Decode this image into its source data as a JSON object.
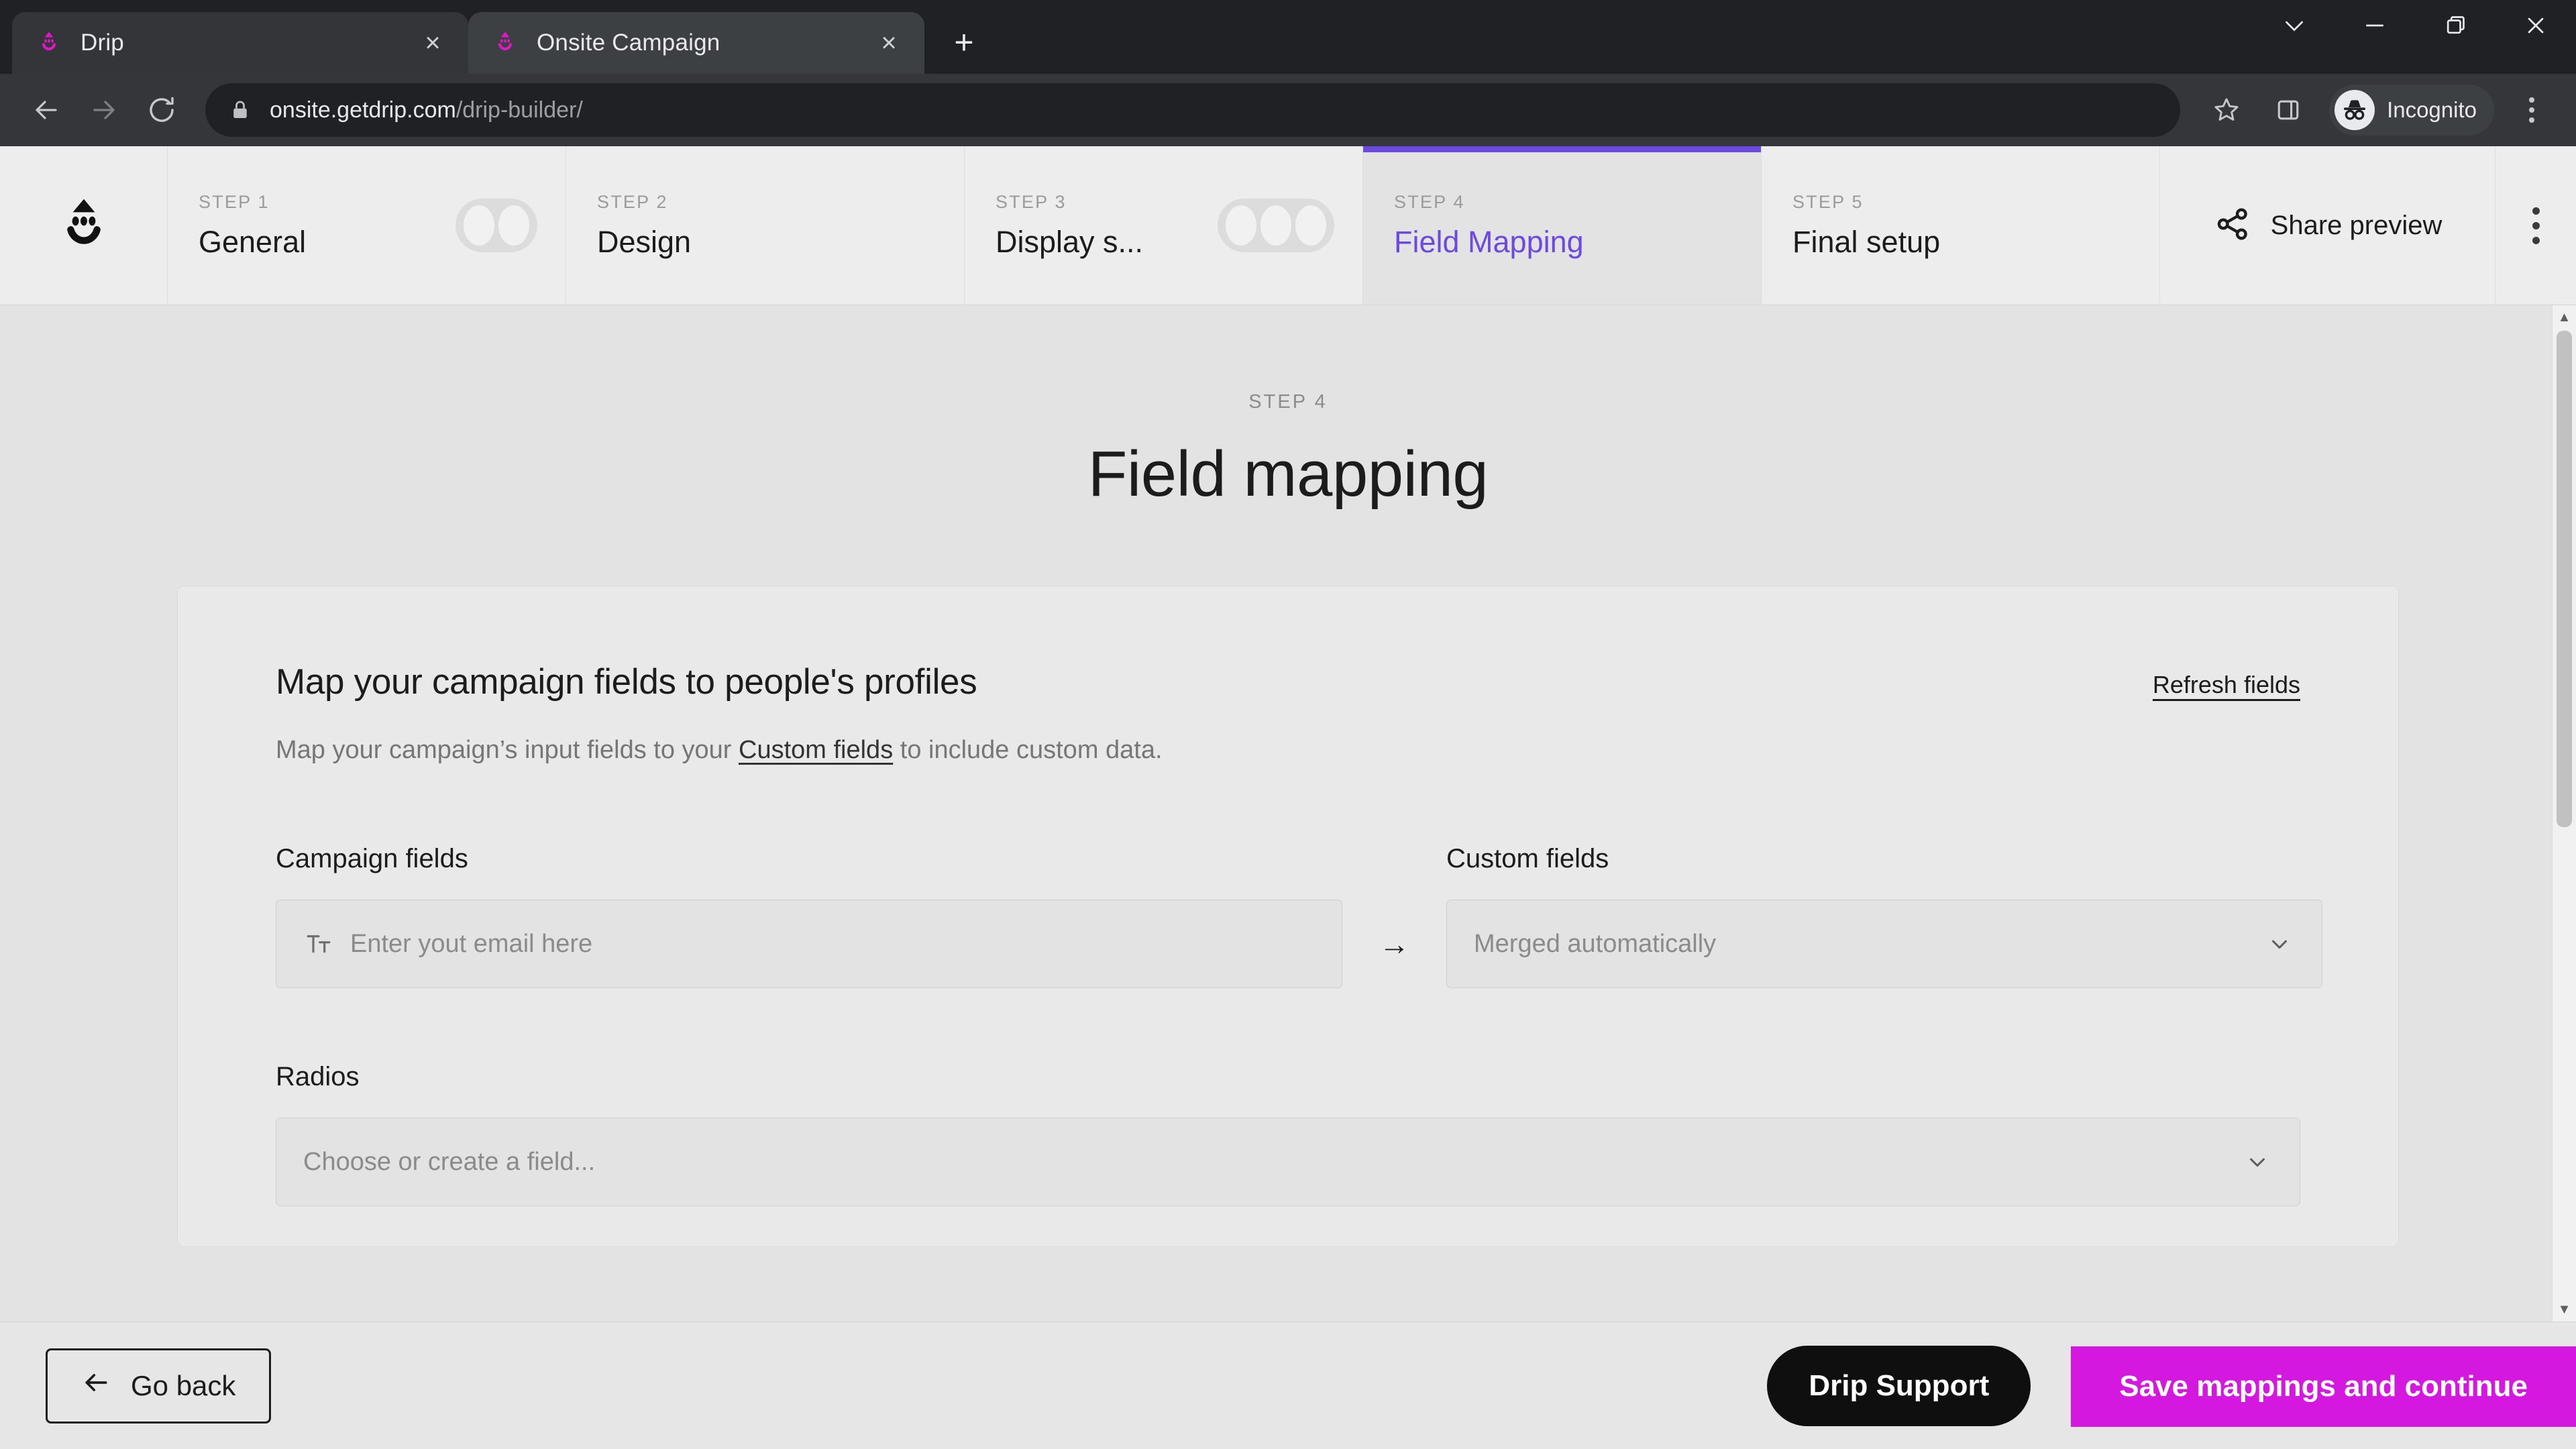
{
  "browser": {
    "tabs": [
      {
        "title": "Drip",
        "favicon": "drip-icon",
        "active": false
      },
      {
        "title": "Onsite Campaign",
        "favicon": "drip-icon",
        "active": true
      }
    ],
    "new_tab_label": "+",
    "close_label": "×",
    "window_controls": {
      "minimize_to_tray_label": "⌄",
      "minimize_label": "─",
      "maximize_label": "❐",
      "close_label": "✕"
    },
    "toolbar": {
      "back_label": "←",
      "forward_label": "→",
      "reload_label": "↻",
      "url_domain": "onsite.getdrip.com",
      "url_path": "/drip-builder/",
      "bookmark_icon": "star-icon",
      "side_panel_icon": "side-panel-icon",
      "profile_label": "Incognito",
      "menu_icon": "kebab-menu-icon"
    }
  },
  "stepbar": {
    "logo": "drip-logo",
    "steps": [
      {
        "num": "STEP 1",
        "label": "General",
        "active": false,
        "pills": 2
      },
      {
        "num": "STEP 2",
        "label": "Design",
        "active": false,
        "pills": 0
      },
      {
        "num": "STEP 3",
        "label": "Display s...",
        "active": false,
        "pills": 3
      },
      {
        "num": "STEP 4",
        "label": "Field Mapping",
        "active": true,
        "pills": 0
      },
      {
        "num": "STEP 5",
        "label": "Final setup",
        "active": false,
        "pills": 0
      }
    ],
    "share_label": "Share preview",
    "share_icon": "share-nodes-icon",
    "overflow_icon": "kebab-menu-icon"
  },
  "main": {
    "eyebrow": "STEP 4",
    "title": "Field mapping",
    "card": {
      "title": "Map your campaign fields to people's profiles",
      "subtitle_before": "Map your campaign’s input fields to your ",
      "subtitle_link": "Custom fields",
      "subtitle_after": " to include custom data.",
      "refresh_label": "Refresh fields",
      "col_left_label": "Campaign fields",
      "col_right_label": "Custom fields",
      "arrow_glyph": "→",
      "rows": [
        {
          "campaign_field_icon": "text-format-icon",
          "campaign_field_value": "Enter yout email here",
          "custom_field_value": "Merged automatically",
          "chevron_icon": "chevron-down-icon"
        }
      ],
      "radios_label": "Radios",
      "radios_placeholder": "Choose or create a field...",
      "radios_chevron_icon": "chevron-down-icon"
    }
  },
  "footer": {
    "back_label": "Go back",
    "back_icon": "arrow-left-icon",
    "support_label": "Drip Support",
    "save_label": "Save mappings and continue"
  },
  "colors": {
    "accent_purple": "#6c49e0",
    "brand_magenta": "#d418e0",
    "drip_pink": "#e016c8",
    "page_bg": "#e3e3e3",
    "chrome_bg": "#202124"
  },
  "scrollbar": {
    "up_glyph": "▲",
    "down_glyph": "▼"
  }
}
